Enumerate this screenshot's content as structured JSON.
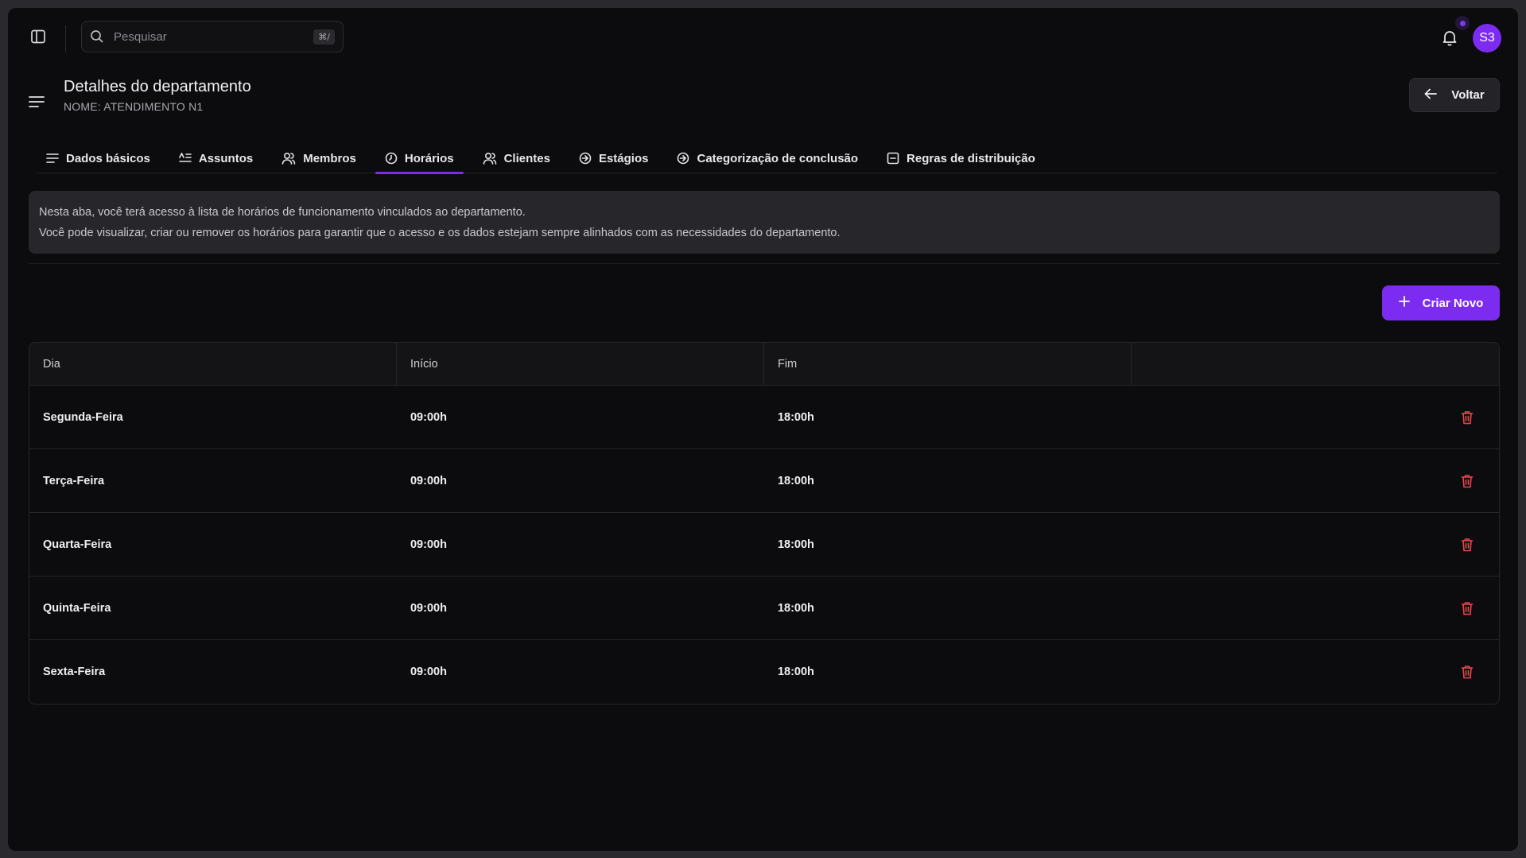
{
  "topbar": {
    "search_placeholder": "Pesquisar",
    "search_shortcut": "⌘/",
    "avatar_initials": "S3"
  },
  "header": {
    "title": "Detalhes do departamento",
    "subtitle": "NOME: ATENDIMENTO N1",
    "back_label": "Voltar"
  },
  "tabs": [
    {
      "label": "Dados básicos",
      "icon": "list-icon"
    },
    {
      "label": "Assuntos",
      "icon": "subject-list-icon"
    },
    {
      "label": "Membros",
      "icon": "users-icon"
    },
    {
      "label": "Horários",
      "icon": "clock-icon",
      "active": true
    },
    {
      "label": "Clientes",
      "icon": "users-icon"
    },
    {
      "label": "Estágios",
      "icon": "arrow-circle-icon"
    },
    {
      "label": "Categorização de conclusão",
      "icon": "arrow-circle-icon"
    },
    {
      "label": "Regras de distribuição",
      "icon": "square-minus-icon"
    }
  ],
  "info": {
    "line1": "Nesta aba, você terá acesso à lista de horários de funcionamento vinculados ao departamento.",
    "line2": "Você pode visualizar, criar ou remover os horários para garantir que o acesso e os dados estejam sempre alinhados com as necessidades do departamento."
  },
  "create_label": "Criar Novo",
  "table": {
    "columns": [
      "Dia",
      "Início",
      "Fim",
      ""
    ],
    "rows": [
      {
        "day": "Segunda-Feira",
        "start": "09:00h",
        "end": "18:00h"
      },
      {
        "day": "Terça-Feira",
        "start": "09:00h",
        "end": "18:00h"
      },
      {
        "day": "Quarta-Feira",
        "start": "09:00h",
        "end": "18:00h"
      },
      {
        "day": "Quinta-Feira",
        "start": "09:00h",
        "end": "18:00h"
      },
      {
        "day": "Sexta-Feira",
        "start": "09:00h",
        "end": "18:00h"
      }
    ]
  },
  "colors": {
    "accent": "#7c2cf0",
    "danger": "#e5484d",
    "background": "#0c0c0e"
  }
}
